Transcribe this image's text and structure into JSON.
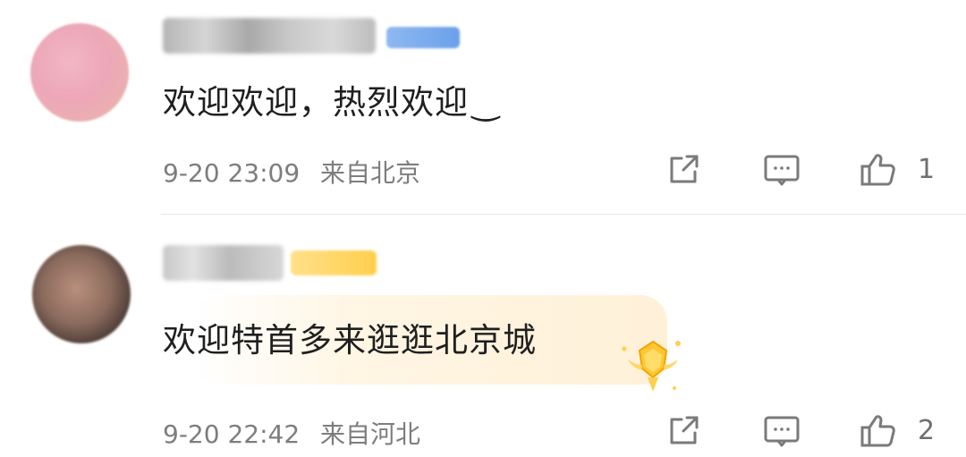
{
  "comments": [
    {
      "text": "欢迎欢迎，热烈欢迎",
      "emoji": "‿",
      "time": "9-20 23:09",
      "location": "来自北京",
      "likes": "1"
    },
    {
      "text": "欢迎特首多来逛逛北京城",
      "time": "9-20 22:42",
      "location": "来自河北",
      "likes": "2"
    }
  ],
  "icons": {
    "share": "share-icon",
    "reply": "comment-icon",
    "like": "thumbs-up-icon"
  }
}
